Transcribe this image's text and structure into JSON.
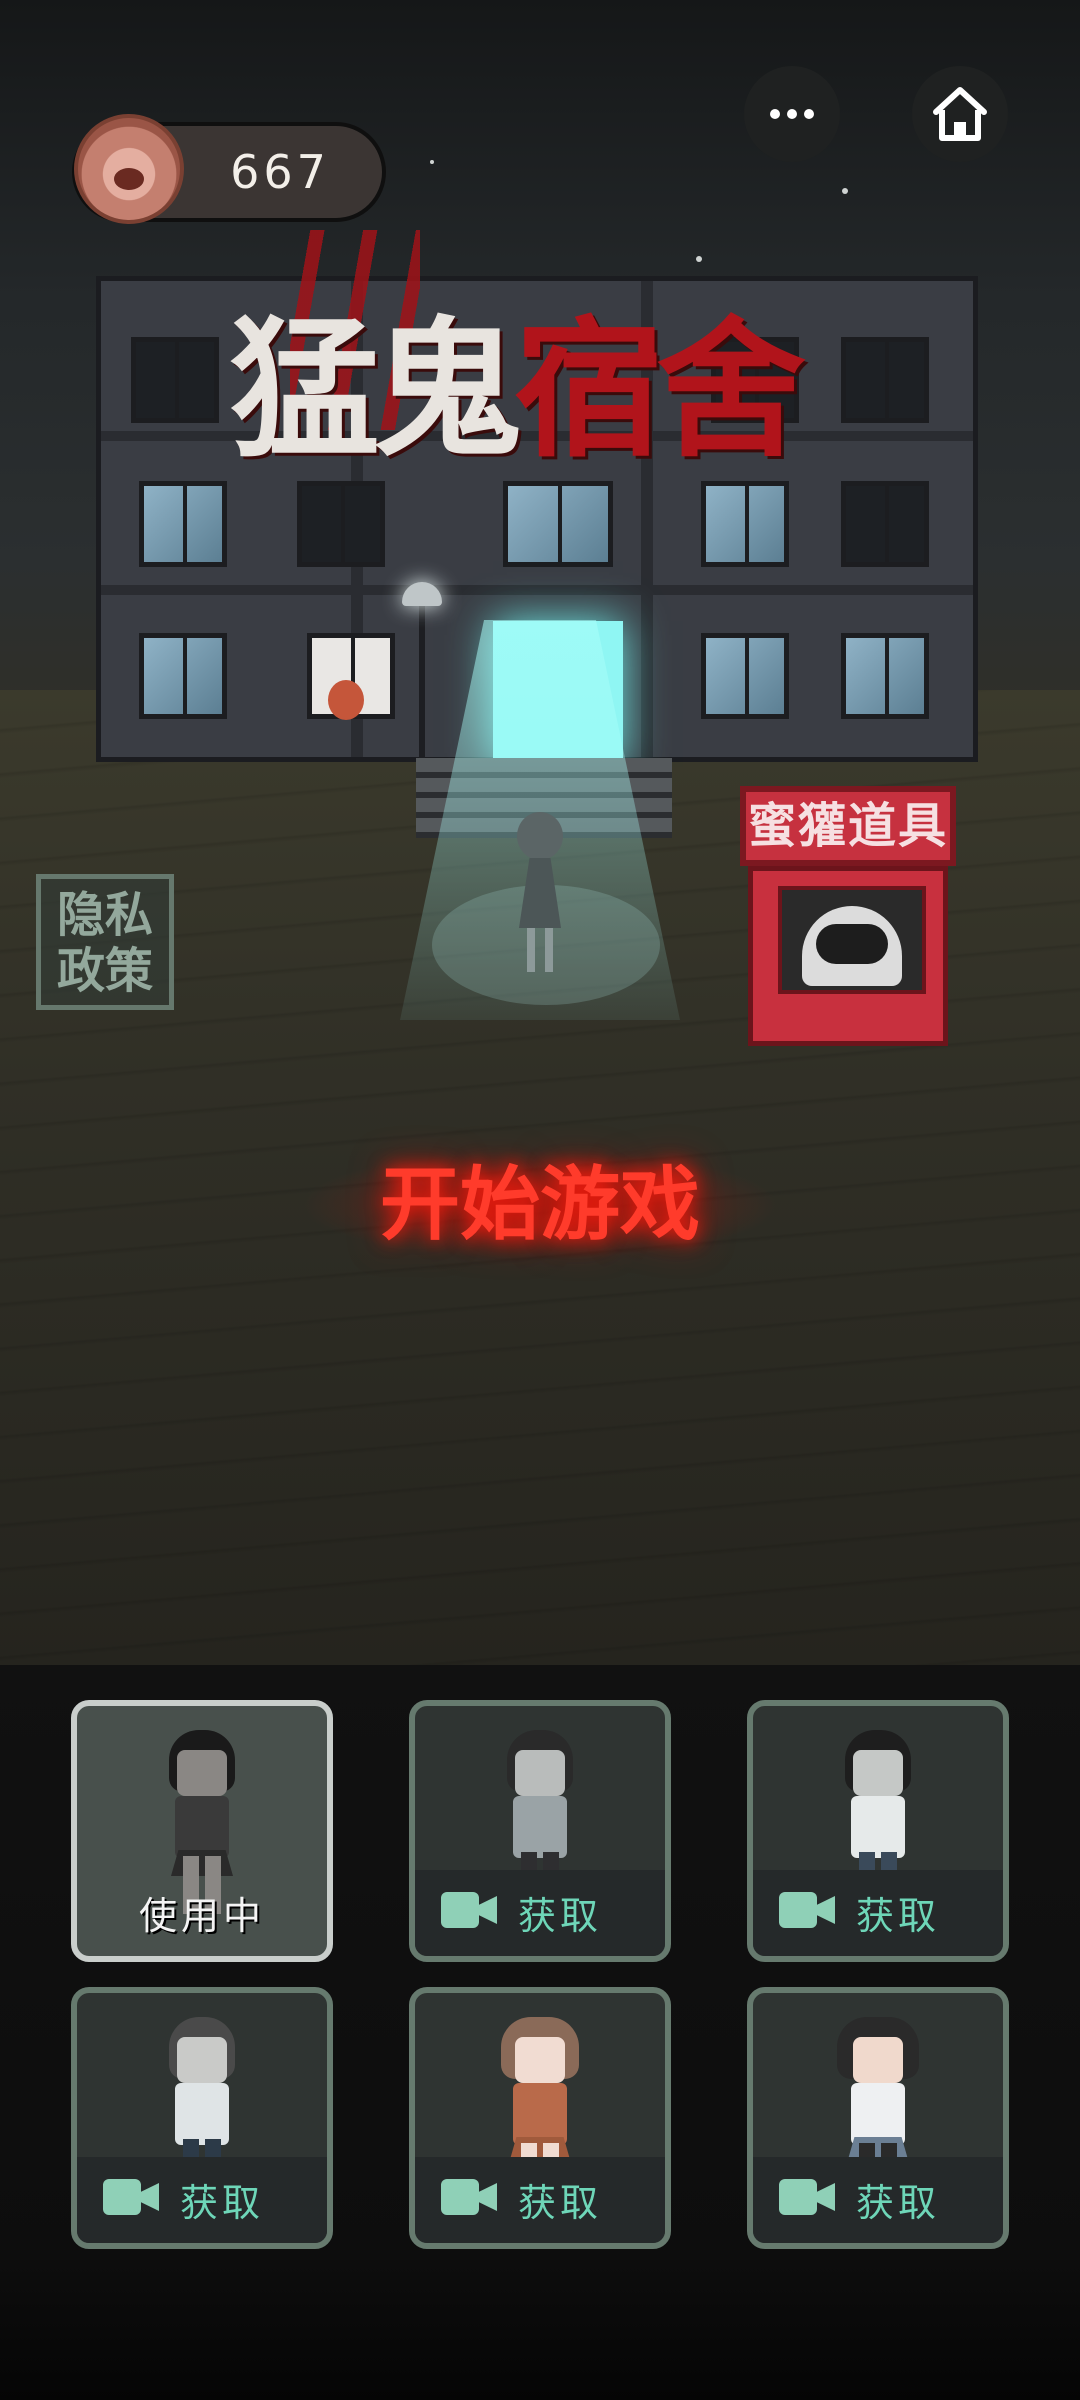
{
  "topbar": {
    "coin_count": "667",
    "more_icon": "more-dots-icon",
    "home_icon": "home-icon"
  },
  "title": {
    "part1": "猛鬼",
    "part2": "宿舍"
  },
  "shop": {
    "sign": "蜜獾道具"
  },
  "privacy": {
    "line1": "隐私",
    "line2": "政策"
  },
  "start_button": "开始游戏",
  "characters": [
    {
      "label": "使用中",
      "state": "in-use"
    },
    {
      "label": "获取",
      "state": "locked",
      "icon": "video-camera-icon"
    },
    {
      "label": "获取",
      "state": "locked",
      "icon": "video-camera-icon"
    },
    {
      "label": "获取",
      "state": "locked",
      "icon": "video-camera-icon"
    },
    {
      "label": "获取",
      "state": "locked",
      "icon": "video-camera-icon"
    },
    {
      "label": "获取",
      "state": "locked",
      "icon": "video-camera-icon"
    }
  ],
  "colors": {
    "start_glow": "#ff3b2b",
    "card_border": "#667a6e",
    "card_active_border": "#c9cecb",
    "get_label": "#6ed6b8",
    "shop_red": "#c6313f"
  }
}
